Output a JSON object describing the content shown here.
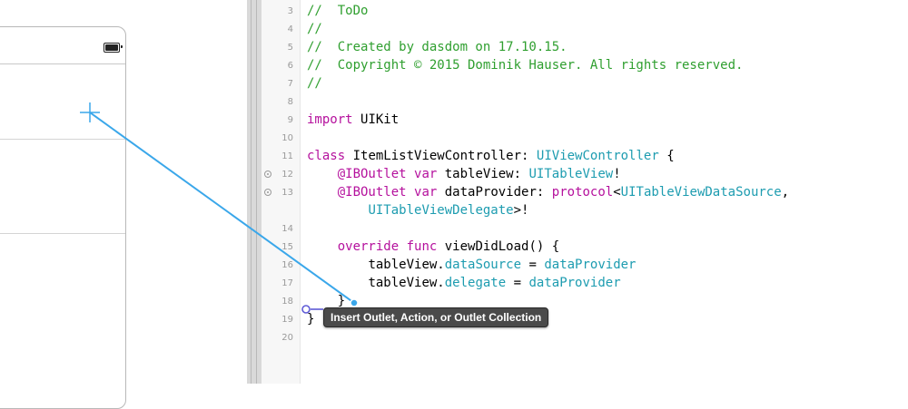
{
  "colors": {
    "keyword": "#b5119d",
    "comment": "#2f9f2f",
    "type": "#1d9cb0",
    "connection_line": "#3aa7ea",
    "tooltip_bg": "#4a4a4a"
  },
  "editor": {
    "lines": [
      {
        "num": "3",
        "text": "//  ToDo"
      },
      {
        "num": "4",
        "text": "//"
      },
      {
        "num": "5",
        "text": "//  Created by dasdom on 17.10.15."
      },
      {
        "num": "6",
        "text": "//  Copyright © 2015 Dominik Hauser. All rights reserved."
      },
      {
        "num": "7",
        "text": "//"
      },
      {
        "num": "8",
        "text": ""
      },
      {
        "num": "9",
        "text": "import UIKit"
      },
      {
        "num": "10",
        "text": ""
      },
      {
        "num": "11",
        "text": "class ItemListViewController: UIViewController {"
      },
      {
        "num": "12",
        "text": "    @IBOutlet var tableView: UITableView!",
        "connected": true
      },
      {
        "num": "13",
        "text": "    @IBOutlet var dataProvider: protocol<UITableViewDataSource,",
        "connected": true
      },
      {
        "num": "",
        "text": "        UITableViewDelegate>!"
      },
      {
        "num": "14",
        "text": ""
      },
      {
        "num": "15",
        "text": "    override func viewDidLoad() {"
      },
      {
        "num": "16",
        "text": "        tableView.dataSource = dataProvider"
      },
      {
        "num": "17",
        "text": "        tableView.delegate = dataProvider"
      },
      {
        "num": "18",
        "text": "    }"
      },
      {
        "num": "19",
        "text": "}"
      },
      {
        "num": "20",
        "text": ""
      }
    ]
  },
  "tooltip": {
    "text": "Insert Outlet, Action, or Outlet Collection"
  },
  "icons": {
    "battery": "battery-icon",
    "drag_target": "crosshair-icon",
    "connection": "outlet-connection-icon"
  }
}
